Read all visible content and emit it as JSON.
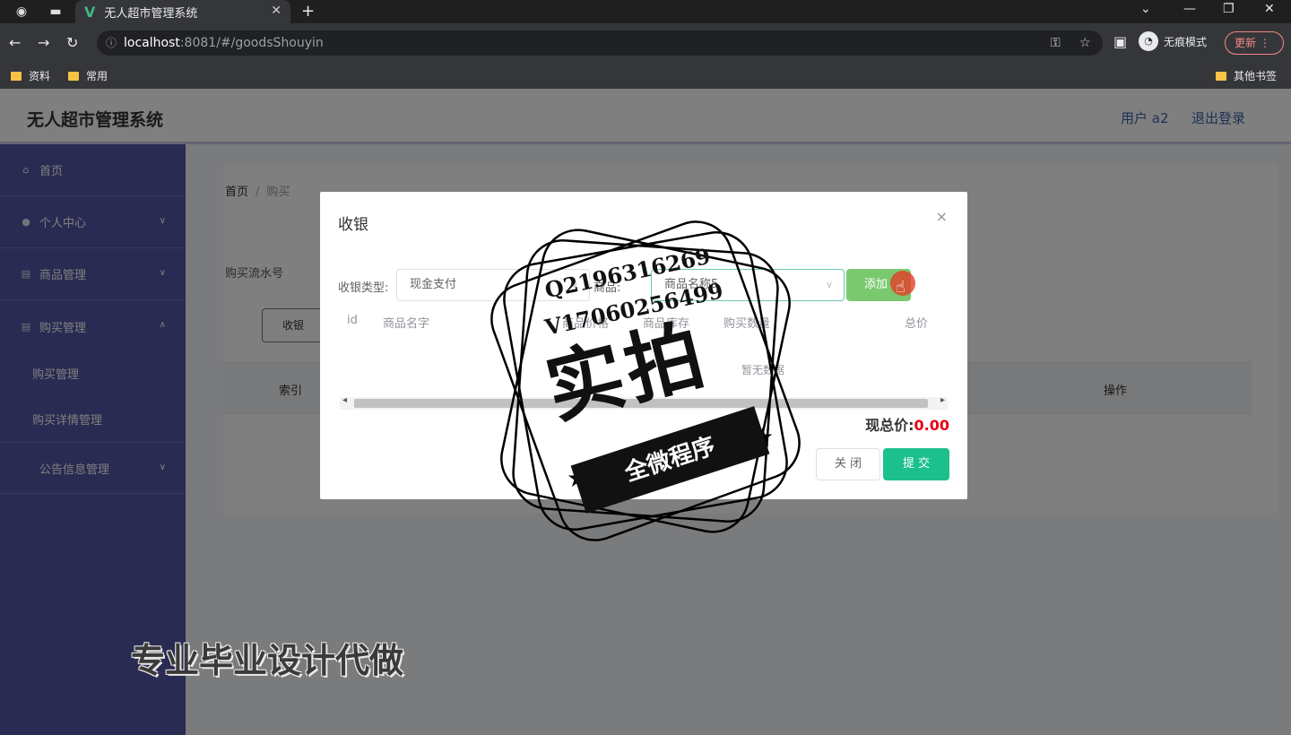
{
  "browser": {
    "tab_title": "无人超市管理系统",
    "url_host": "localhost",
    "url_path": ":8081/#/goodsShouyin",
    "incognito_label": "无痕模式",
    "update_label": "更新",
    "bookmarks": [
      "资料",
      "常用"
    ],
    "bookmarks_other": "其他书签"
  },
  "header": {
    "title": "无人超市管理系统",
    "user": "用户 a2",
    "logout": "退出登录"
  },
  "sidebar": {
    "items": [
      {
        "label": "首页",
        "icon": "home-icon"
      },
      {
        "label": "个人中心",
        "icon": "user-icon"
      },
      {
        "label": "商品管理",
        "icon": "goods-icon"
      },
      {
        "label": "购买管理",
        "icon": "cart-icon"
      },
      {
        "label": "公告信息管理",
        "icon": "notice-icon"
      }
    ],
    "submenu": [
      "购买管理",
      "购买详情管理"
    ]
  },
  "page": {
    "breadcrumb_home": "首页",
    "breadcrumb_sep": "/",
    "breadcrumb_current": "购买",
    "search_label": "购买流水号",
    "shouyin_button": "收银",
    "table_headers": {
      "index": "索引",
      "op": "操作"
    }
  },
  "dialog": {
    "title": "收银",
    "close_icon": "×",
    "type_label": "收银类型:",
    "type_value": "现金支付",
    "goods_label": "商品:",
    "goods_value": "商品名称5",
    "add_button": "添加",
    "columns": [
      "id",
      "商品名字",
      "商品价格",
      "商品库存",
      "购买数量",
      "总价"
    ],
    "empty_text": "暂无数据",
    "total_label": "现总价:",
    "total_value": "0.00",
    "close_button": "关 闭",
    "submit_button": "提 交"
  },
  "watermark": {
    "line1": "Q2196316269",
    "line2": "V17060256499",
    "big": "实拍",
    "banner": "全微程序"
  },
  "caption": "专业毕业设计代做",
  "colors": {
    "sidebar": "#5557a4",
    "add_button": "#7bc96f",
    "submit_button": "#1bc08d",
    "total_value": "#e60012"
  }
}
